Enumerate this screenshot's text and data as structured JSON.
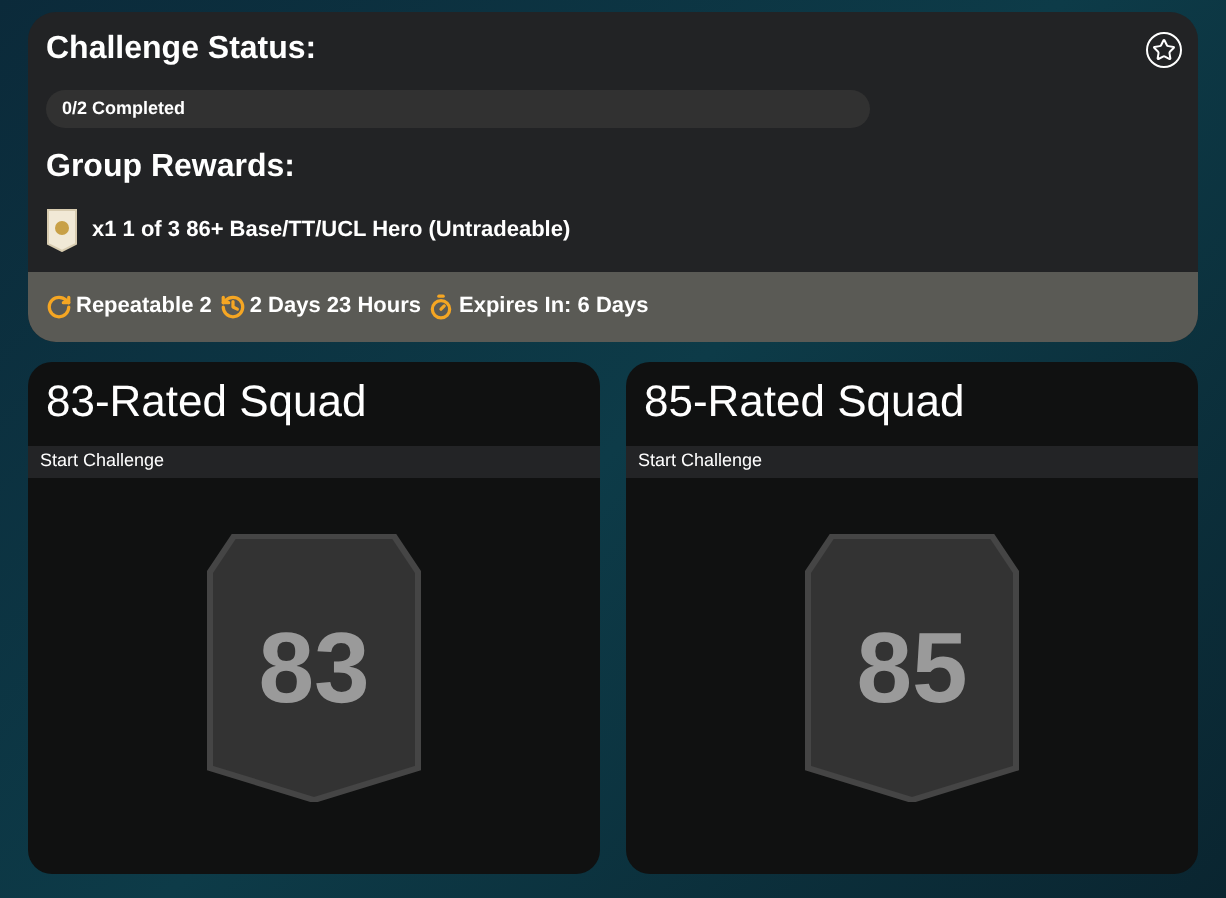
{
  "challenge": {
    "title": "Challenge Status:",
    "progress": {
      "label": "0/2 Completed",
      "level": 0
    },
    "rewards_title": "Group Rewards:",
    "reward": "x1 1 of 3 86+ Base/TT/UCL Hero (Untradeable)",
    "footer": [
      {
        "kind": "repeat",
        "text": "Repeatable 2"
      },
      {
        "kind": "history",
        "text": "2 Days 23 Hours"
      },
      {
        "kind": "timer",
        "text": "Expires In: 6 Days"
      }
    ]
  },
  "squads": [
    {
      "title": "83-Rated Squad",
      "action": "Start Challenge",
      "rating": "83"
    },
    {
      "title": "85-Rated Squad",
      "action": "Start Challenge",
      "rating": "85"
    }
  ]
}
